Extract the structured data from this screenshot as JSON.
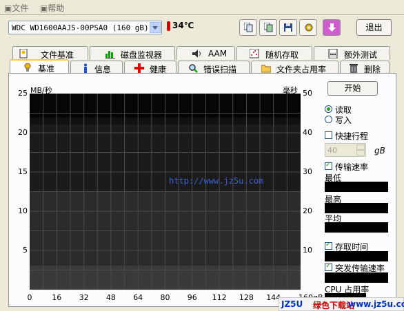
{
  "menu": {
    "file": "文件",
    "help": "帮助"
  },
  "drive": {
    "name": "WDC WD1600AAJS-00PSA0  (160 gB)",
    "temperature": "34℃"
  },
  "toolbar": {
    "exit": "退出"
  },
  "tabs_top": [
    "文件基准",
    "磁盘监视器",
    "AAM",
    "随机存取",
    "额外测试"
  ],
  "tabs_bottom": [
    "基准",
    "信息",
    "健康",
    "错误扫描",
    "文件夹占用率",
    "删除"
  ],
  "chart_data": {
    "type": "line",
    "ylabel_left": "MB/秒",
    "ylabel_right": "毫秒",
    "xlabel": "gB",
    "y_left_ticks": [
      "25",
      "20",
      "15",
      "10",
      "5"
    ],
    "y_right_ticks": [
      "50",
      "40",
      "30",
      "20",
      "10"
    ],
    "x_ticks": [
      "0",
      "16",
      "32",
      "48",
      "64",
      "80",
      "96",
      "112",
      "128",
      "144",
      "160"
    ],
    "xlim": [
      0,
      160
    ],
    "ylim_left": [
      0,
      25
    ],
    "ylim_right": [
      0,
      50
    ],
    "series": []
  },
  "watermark": "http://www.jz5u.com",
  "controls": {
    "start": "开始",
    "read": "读取",
    "write": "写入",
    "quick": "快捷行程",
    "quick_value": "40",
    "quick_unit": "gB",
    "transfer": "传输速率",
    "min": "最低",
    "max": "最高",
    "avg": "平均",
    "access": "存取时间",
    "burst": "突发传输速率",
    "cpu": "CPU 占用率"
  },
  "banner": {
    "a": "JZ5U",
    "b": "绿色下载站",
    "c": "www.jz5u.com"
  }
}
